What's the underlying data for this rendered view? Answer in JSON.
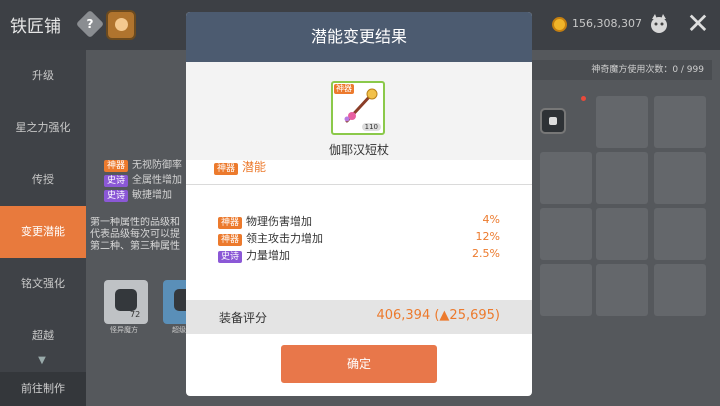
{
  "header": {
    "title": "铁匠铺",
    "help_icon": "?",
    "mesos": "156,308,307",
    "close_icon": "✕"
  },
  "sidebar": {
    "items": [
      "升级",
      "星之力强化",
      "传授",
      "变更潜能",
      "铭文强化",
      "超越"
    ],
    "active_index": 3,
    "bottom": "前往制作"
  },
  "background": {
    "attempts": "神奇魔方使用次数：0 / 999",
    "options": [
      {
        "tag": "神器",
        "label": "无视防御率"
      },
      {
        "tag": "史诗",
        "label": "全属性增加"
      },
      {
        "tag": "史诗",
        "label": "敏捷增加"
      }
    ],
    "desc": [
      "第一种属性的品级和",
      "代表品级每次可以提",
      "第二种、第三种属性"
    ],
    "cube_count": "72",
    "cube_labels": [
      "怪异魔方",
      "超级"
    ]
  },
  "dialog": {
    "title": "潜能变更结果",
    "item_name": "伽耶汉短杖",
    "item_badge": "神器",
    "item_level": "110",
    "potential_label": "潜能",
    "potential_tag": "神器",
    "stats": [
      {
        "tag": "神器",
        "label": "物理伤害增加",
        "value": "4%"
      },
      {
        "tag": "神器",
        "label": "领主攻击力增加",
        "value": "12%"
      },
      {
        "tag": "史诗",
        "label": "力量增加",
        "value": "2.5%"
      }
    ],
    "score_label": "装备评分",
    "score_value": "406,394 (▲25,695)",
    "confirm_label": "确定"
  },
  "colors": {
    "legendary_tag": "#ec7a2d",
    "epic_tag": "#8b58d6",
    "header_bg": "#4c5b70",
    "confirm_bg": "#e8774a"
  }
}
